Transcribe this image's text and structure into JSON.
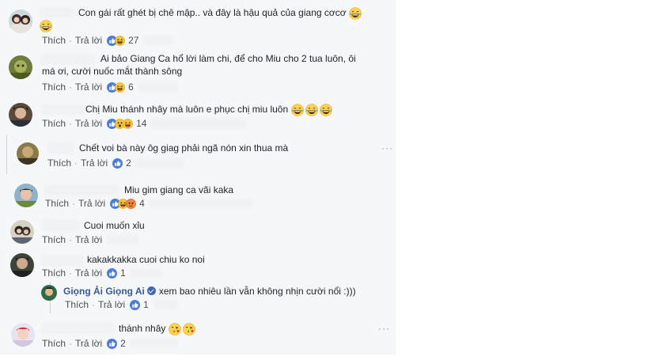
{
  "actions": {
    "like": "Thích",
    "reply": "Trả lời",
    "sep": "·"
  },
  "comments": [
    {
      "text": "Con gái rất ghét bị chê mập.. và đây là hậu quả của giang cơcơ",
      "reaction_count": "27"
    },
    {
      "text": "Ai bảo Giang Ca hổ lời làm chi, để cho Miu cho 2 tua luôn, ôi má ơi, cười nuốc mắt thành sông",
      "reaction_count": "6"
    },
    {
      "text": "Chị Miu thánh nhây mà luôn e phục chị miu luôn",
      "reaction_count": "14"
    },
    {
      "text": "Chết voi bà này ôg giag phải ngã nón xin thua mà",
      "reaction_count": "2"
    },
    {
      "text": "Miu gim giang ca vãi kaka",
      "reaction_count": "4"
    },
    {
      "text": "Cuoi muốn xỉu",
      "reaction_count": ""
    },
    {
      "text": "kakakkakka cuoi chiu ko noi",
      "reaction_count": "1"
    },
    {
      "author": "Giọng Ải Giọng Ai",
      "text": "xem bao nhiêu lần vẫn không nhịn cười nổi :)))",
      "reaction_count": "1"
    },
    {
      "text": "thánh nhây",
      "reaction_count": "2"
    }
  ],
  "more_label": "···",
  "icons": {
    "like": "like-reaction-icon",
    "haha": "haha-reaction-icon",
    "wow": "wow-reaction-icon",
    "angry": "angry-reaction-icon",
    "laugh_emoji": "laughing-emoji",
    "kiss_emoji": "kissing-heart-emoji",
    "verified": "verified-badge-icon"
  },
  "colors": {
    "like_blue": "#4a7dd6",
    "name_link": "#365899",
    "haha_yellow": "#f7c53b"
  }
}
